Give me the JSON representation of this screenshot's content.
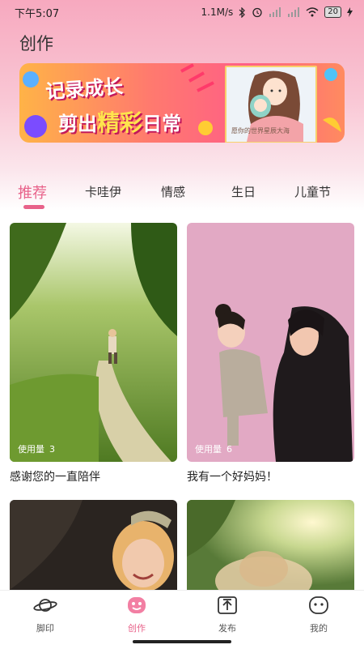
{
  "status": {
    "time": "下午5:07",
    "network_speed": "1.1M/s",
    "battery": "20"
  },
  "page_title": "创作",
  "banner": {
    "line1": "记录成长",
    "line2_prefix": "剪出",
    "line2_highlight": "精彩",
    "line2_suffix": "日常",
    "caption": "愿你的世界星辰大海"
  },
  "tabs": [
    {
      "label": "推荐",
      "active": true
    },
    {
      "label": "卡哇伊",
      "active": false
    },
    {
      "label": "情感",
      "active": false
    },
    {
      "label": "生日",
      "active": false
    },
    {
      "label": "儿童节",
      "active": false
    }
  ],
  "cards": [
    {
      "title": "感谢您的一直陪伴",
      "usage_label": "使用量",
      "usage_count": "3"
    },
    {
      "title": "我有一个好妈妈！",
      "usage_label": "使用量",
      "usage_count": "6"
    },
    {
      "title": "",
      "usage_label": "",
      "usage_count": ""
    },
    {
      "title": "",
      "usage_label": "",
      "usage_count": ""
    }
  ],
  "bottom_nav": [
    {
      "label": "脚印",
      "icon": "planet-icon",
      "active": false
    },
    {
      "label": "创作",
      "icon": "smile-face-icon",
      "active": true
    },
    {
      "label": "发布",
      "icon": "upload-icon",
      "active": false
    },
    {
      "label": "我的",
      "icon": "face-icon",
      "active": false
    }
  ],
  "colors": {
    "accent": "#e8628a",
    "header_gradient_top": "#f7a9bf"
  }
}
